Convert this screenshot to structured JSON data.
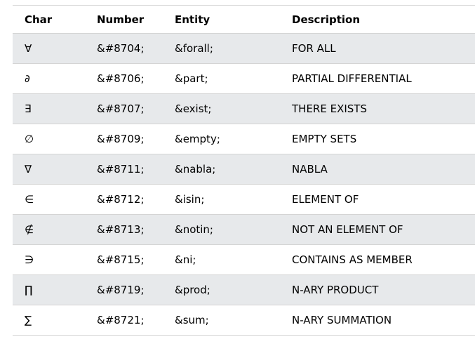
{
  "table": {
    "headers": [
      "Char",
      "Number",
      "Entity",
      "Description"
    ],
    "rows": [
      {
        "char": "∀",
        "number": "&#8704;",
        "entity": "&forall;",
        "description": "FOR ALL"
      },
      {
        "char": "∂",
        "number": "&#8706;",
        "entity": "&part;",
        "description": "PARTIAL DIFFERENTIAL"
      },
      {
        "char": "∃",
        "number": "&#8707;",
        "entity": "&exist;",
        "description": "THERE EXISTS"
      },
      {
        "char": "∅",
        "number": "&#8709;",
        "entity": "&empty;",
        "description": "EMPTY SETS"
      },
      {
        "char": "∇",
        "number": "&#8711;",
        "entity": "&nabla;",
        "description": "NABLA"
      },
      {
        "char": "∈",
        "number": "&#8712;",
        "entity": "&isin;",
        "description": "ELEMENT OF"
      },
      {
        "char": "∉",
        "number": "&#8713;",
        "entity": "&notin;",
        "description": "NOT AN ELEMENT OF"
      },
      {
        "char": "∋",
        "number": "&#8715;",
        "entity": "&ni;",
        "description": "CONTAINS AS MEMBER"
      },
      {
        "char": "∏",
        "number": "&#8719;",
        "entity": "&prod;",
        "description": "N-ARY PRODUCT"
      },
      {
        "char": "∑",
        "number": "&#8721;",
        "entity": "&sum;",
        "description": "N-ARY SUMMATION"
      }
    ]
  },
  "colors": {
    "stripe": "#e7e9eb",
    "border": "#d4d4d4"
  }
}
